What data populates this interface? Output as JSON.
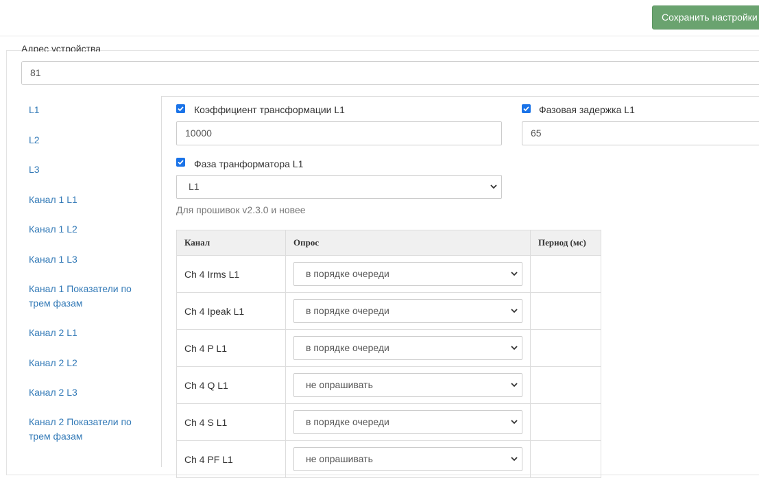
{
  "toolbar": {
    "save_label": "Сохранить настройки"
  },
  "device": {
    "address_label": "Адрес устройства",
    "address_value": "81"
  },
  "sidebar": {
    "items": [
      {
        "label": "L1"
      },
      {
        "label": "L2"
      },
      {
        "label": "L3"
      },
      {
        "label": "Канал 1 L1"
      },
      {
        "label": "Канал 1 L2"
      },
      {
        "label": "Канал 1 L3"
      },
      {
        "label": "Канал 1 Показатели по трем фазам"
      },
      {
        "label": "Канал 2 L1"
      },
      {
        "label": "Канал 2 L2"
      },
      {
        "label": "Канал 2 L3"
      },
      {
        "label": "Канал 2 Показатели по трем фазам"
      }
    ]
  },
  "settings": {
    "ratio": {
      "label": "Коэффициент трансформации L1",
      "value": "10000",
      "checked": true
    },
    "delay": {
      "label": "Фазовая задержка L1",
      "value": "65",
      "checked": true
    },
    "phase": {
      "label": "Фаза транформатора L1",
      "value": "L1",
      "checked": true
    },
    "hint": "Для прошивок v2.3.0 и новее"
  },
  "table": {
    "headers": [
      "Канал",
      "Опрос",
      "Период (мс)"
    ],
    "rows": [
      {
        "channel": "Ch 4 Irms L1",
        "poll": "в порядке очереди",
        "period": ""
      },
      {
        "channel": "Ch 4 Ipeak L1",
        "poll": "в порядке очереди",
        "period": ""
      },
      {
        "channel": "Ch 4 P L1",
        "poll": "в порядке очереди",
        "period": ""
      },
      {
        "channel": "Ch 4 Q L1",
        "poll": "не опрашивать",
        "period": ""
      },
      {
        "channel": "Ch 4 S L1",
        "poll": "в порядке очереди",
        "period": ""
      },
      {
        "channel": "Ch 4 PF L1",
        "poll": "не опрашивать",
        "period": ""
      }
    ]
  },
  "colors": {
    "accent": "#337ab7",
    "save_button": "#6aa36f",
    "checkbox": "#1a73e8"
  }
}
